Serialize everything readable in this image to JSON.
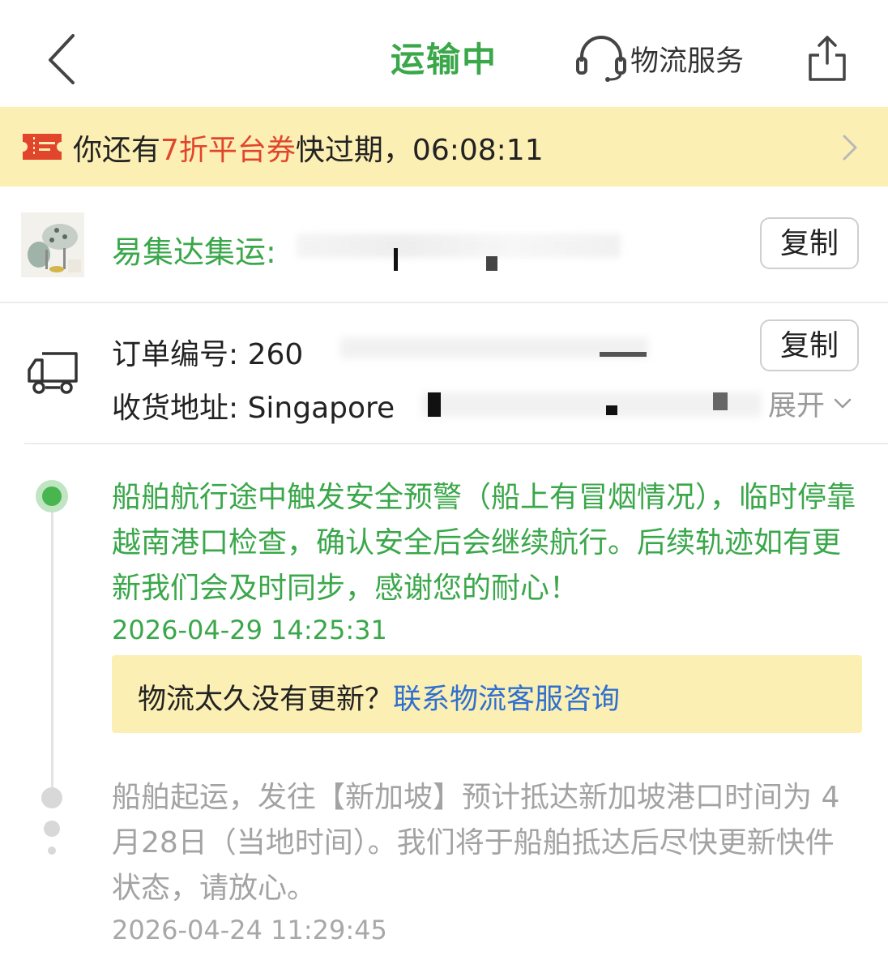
{
  "header": {
    "title": "运输中",
    "service_label": "物流服务",
    "back_icon": "chevron-left-icon",
    "service_icon": "headset-icon",
    "share_icon": "share-icon"
  },
  "coupon": {
    "prefix": "你还有",
    "highlight": "7折平台券",
    "suffix": "快过期，06:08:11",
    "highlight_color": "#e1462d"
  },
  "shop": {
    "name": "易集达集运:",
    "copy_label": "复制"
  },
  "order": {
    "number_label": "订单编号: ",
    "number_value": "260",
    "address_label": "收货地址: ",
    "address_value": "Singapore",
    "copy_label": "复制",
    "expand_label": "展开"
  },
  "timeline": {
    "events": [
      {
        "text": "船舶航行途中触发安全预警（船上有冒烟情况），临时停靠越南港口检查，确认安全后会继续航行。后续轨迹如有更新我们会及时同步，感谢您的耐心！",
        "time": "2026-04-29 14:25:31"
      },
      {
        "text": "船舶起运，发往【新加坡】预计抵达新加坡港口时间为 4月28日（当地时间）。我们将于船舶抵达后尽快更新快件状态，请放心。",
        "time": "2026-04-24 11:29:45"
      }
    ],
    "help_prefix": "物流太久没有更新？",
    "help_link": "联系物流客服咨询"
  },
  "colors": {
    "accent_green": "#3aa74a",
    "banner_yellow": "#fbefb4",
    "link_blue": "#2e6fd0"
  }
}
